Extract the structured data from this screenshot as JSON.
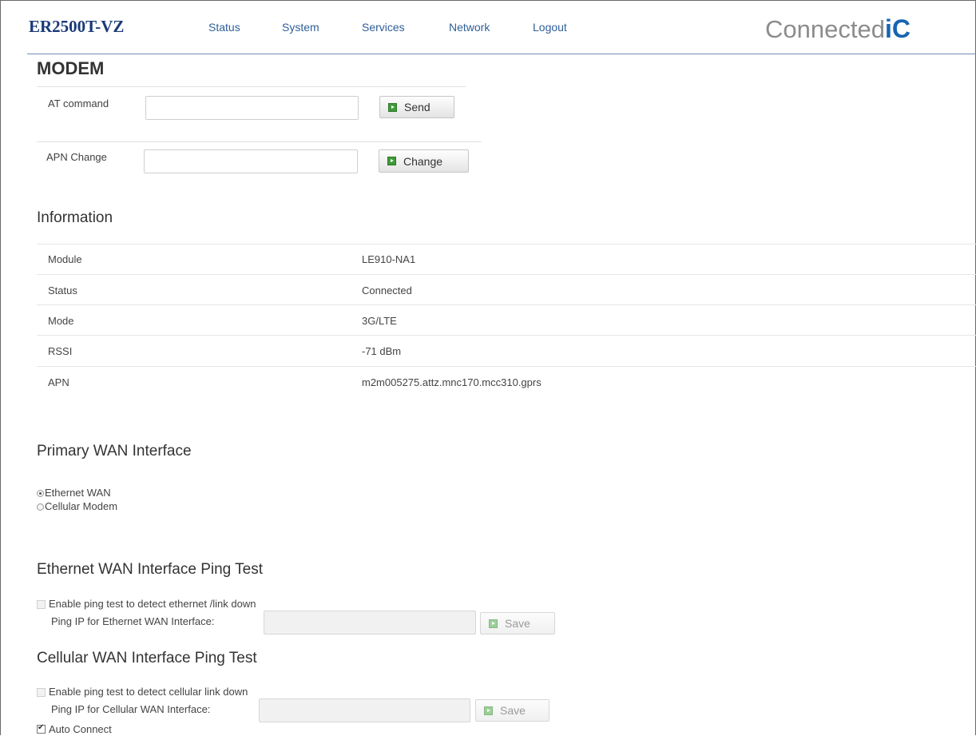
{
  "header": {
    "brand": "ER2500T-VZ",
    "nav": [
      "Status",
      "System",
      "Services",
      "Network",
      "Logout"
    ],
    "logo_text": "Connected",
    "logo_mark": "iC"
  },
  "modem": {
    "title": "MODEM",
    "at_command": {
      "label": "AT command",
      "value": "",
      "button": "Send"
    },
    "apn_change": {
      "label": "APN Change",
      "value": "",
      "button": "Change"
    }
  },
  "information": {
    "title": "Information",
    "rows": [
      {
        "label": "Module",
        "value": "LE910-NA1"
      },
      {
        "label": "Status",
        "value": "Connected"
      },
      {
        "label": "Mode",
        "value": "3G/LTE"
      },
      {
        "label": "RSSI",
        "value": "-71 dBm"
      },
      {
        "label": "APN",
        "value": "m2m005275.attz.mnc170.mcc310.gprs"
      }
    ]
  },
  "primary_wan": {
    "title": "Primary WAN Interface",
    "options": [
      {
        "label": "Ethernet WAN",
        "selected": true
      },
      {
        "label": "Cellular Modem",
        "selected": false
      }
    ]
  },
  "ethernet_ping": {
    "title": "Ethernet WAN Interface Ping Test",
    "enable_label": "Enable ping test to detect ethernet /link down",
    "enabled": false,
    "ip_label": "Ping IP for Ethernet WAN Interface:",
    "ip_value": "",
    "button": "Save"
  },
  "cellular_ping": {
    "title": "Cellular WAN Interface Ping Test",
    "enable_label": "Enable ping test to detect cellular link down",
    "enabled": false,
    "ip_label": "Ping IP for Cellular WAN Interface:",
    "ip_value": "",
    "button": "Save"
  },
  "auto_connect": {
    "label": "Auto Connect",
    "checked": true
  },
  "colors": {
    "brand": "#1a3a78",
    "nav": "#2f5f98",
    "logo_accent": "#1665b0",
    "button_icon": "#3f9a3a"
  }
}
